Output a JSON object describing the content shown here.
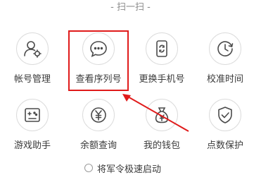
{
  "header": {
    "title": "- 扫一扫 -"
  },
  "tiles": [
    {
      "label": "帐号管理",
      "icon": "account-manage-icon"
    },
    {
      "label": "查看序列号",
      "icon": "message-icon"
    },
    {
      "label": "更换手机号",
      "icon": "phone-swap-icon"
    },
    {
      "label": "校准时间",
      "icon": "clock-icon"
    },
    {
      "label": "游戏助手",
      "icon": "gamepad-icon"
    },
    {
      "label": "余额查询",
      "icon": "yuan-coin-icon"
    },
    {
      "label": "我的钱包",
      "icon": "wallet-bag-icon"
    },
    {
      "label": "点数保护",
      "icon": "shield-check-icon"
    }
  ],
  "footer": {
    "option_label": "将军令极速启动",
    "checked": false
  },
  "colors": {
    "highlight": "#e01b1b",
    "icon_stroke": "#4a4a4a"
  }
}
